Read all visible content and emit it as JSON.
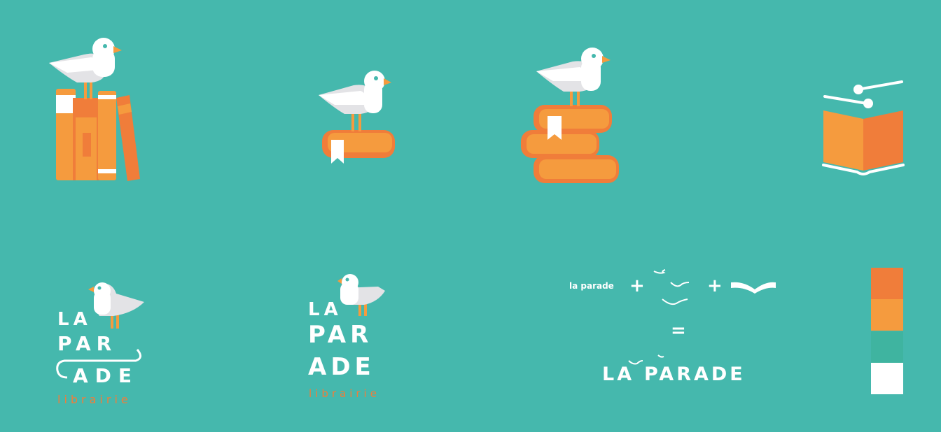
{
  "colors": {
    "background": "#45b8ad",
    "orange_dark": "#f07d3a",
    "orange": "#f59b3e",
    "teal": "#3fb4a0",
    "white": "#ffffff",
    "gull_grey": "#e3e3e6"
  },
  "icons": [
    {
      "name": "seagull-on-books-upright-icon"
    },
    {
      "name": "seagull-on-single-book-icon"
    },
    {
      "name": "seagull-on-book-stack-icon"
    },
    {
      "name": "open-book-with-dots-icon"
    }
  ],
  "logo_a": {
    "line1": "LA",
    "line2": "PAR",
    "line3": "ADE",
    "sub": "librairie"
  },
  "logo_b": {
    "line1": "LA",
    "line2": "PAR",
    "line3": "ADE",
    "sub": "librairie"
  },
  "equation": {
    "term1": "la parade",
    "plus": "+",
    "equals": "=",
    "result_left": "LA",
    "result_right": "PARADE"
  },
  "palette": [
    "#f07d3a",
    "#f59b3e",
    "#3fb4a0",
    "#ffffff"
  ]
}
